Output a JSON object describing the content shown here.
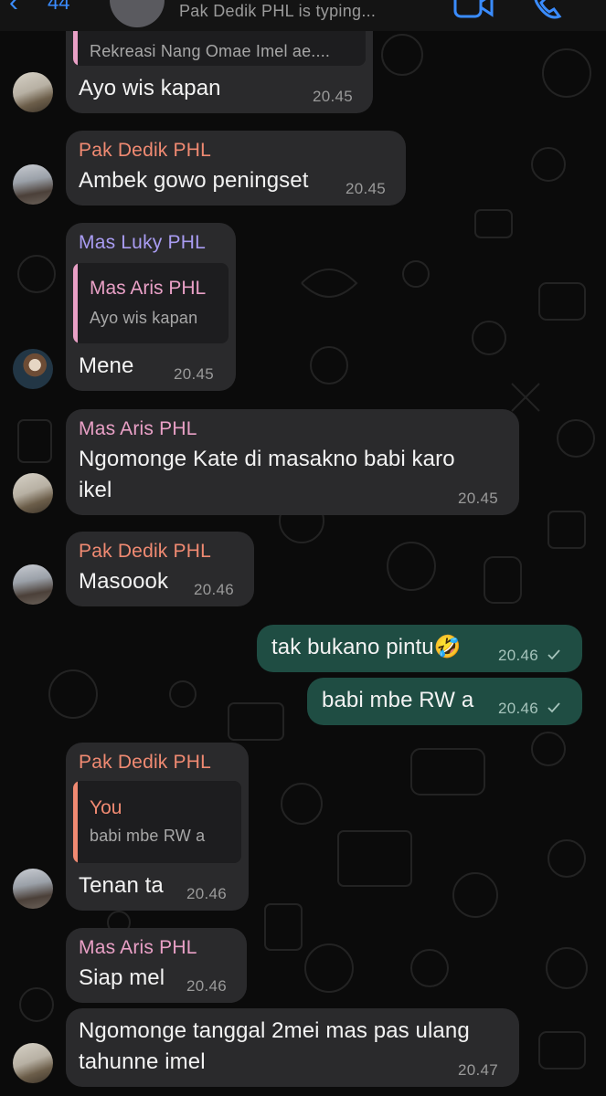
{
  "header": {
    "back_count": "44",
    "typing": "Pak Dedik PHL is typing..."
  },
  "messages": [
    {
      "quote_text": "Rekreasi Nang Omae Imel ae....",
      "text": "Ayo wis kapan",
      "time": "20.45"
    },
    {
      "sender": "Pak Dedik PHL",
      "text": "Ambek gowo peningset",
      "time": "20.45"
    },
    {
      "sender": "Mas Luky PHL",
      "quote_name": "Mas Aris PHL",
      "quote_text": "Ayo wis kapan",
      "text": "Mene",
      "time": "20.45"
    },
    {
      "sender": "Mas Aris PHL",
      "text_line1": "Ngomonge Kate di masakno babi karo",
      "text_line2": "ikel",
      "time": "20.45"
    },
    {
      "sender": "Pak Dedik PHL",
      "text": "Masoook",
      "time": "20.46"
    },
    {
      "text": "tak bukano pintu",
      "emoji": "🤣",
      "time": "20.46"
    },
    {
      "text": "babi mbe RW a",
      "time": "20.46"
    },
    {
      "sender": "Pak Dedik PHL",
      "quote_name": "You",
      "quote_text": "babi mbe RW a",
      "text": "Tenan ta",
      "time": "20.46"
    },
    {
      "sender": "Mas Aris PHL",
      "text": "Siap mel",
      "time": "20.46"
    },
    {
      "text_line1": "Ngomonge tanggal 2mei mas pas ulang",
      "text_line2": "tahunne imel",
      "time": "20.47"
    }
  ],
  "colors": {
    "pak_dedik": "#f08a72",
    "mas_luky": "#a99cf2",
    "mas_aris": "#e9a0c6",
    "you": "#f08a72",
    "incoming_bubble": "#2a2a2c",
    "outgoing_bubble": "#1f4d43"
  }
}
